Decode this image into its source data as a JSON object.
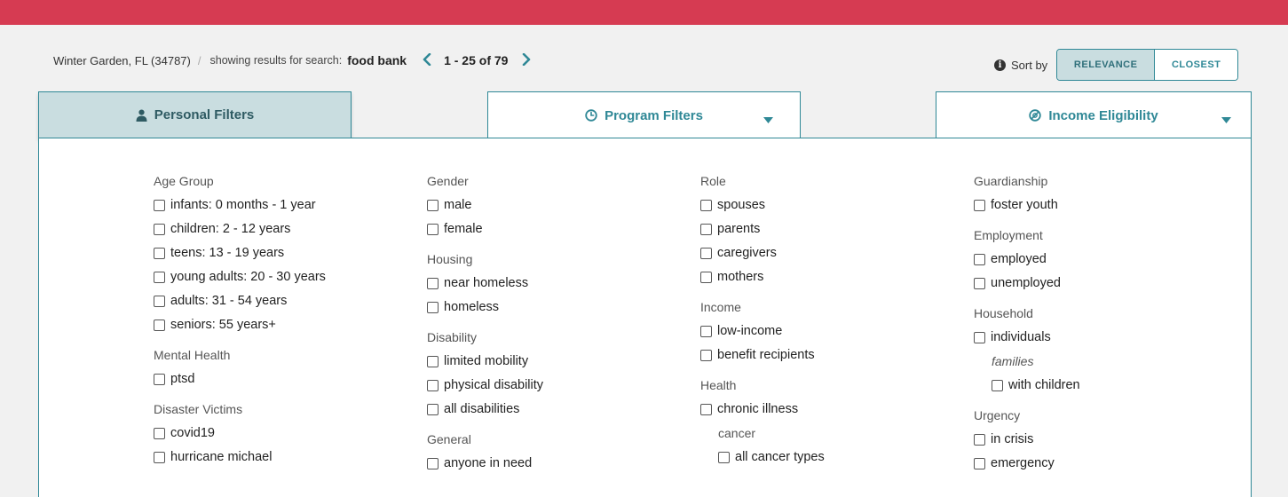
{
  "results": {
    "location": "Winter Garden, FL (34787)",
    "separator": "/",
    "search_prefix": "showing results for search:",
    "query": "food bank",
    "range": "1 - 25 of 79"
  },
  "sort": {
    "label": "Sort by",
    "options": [
      "RELEVANCE",
      "CLOSEST"
    ],
    "selected": "RELEVANCE"
  },
  "tabs": {
    "personal": "Personal Filters",
    "program": "Program Filters",
    "income": "Income Eligibility"
  },
  "colors": {
    "brand_red": "#d63b52",
    "teal": "#2f8896",
    "tab_active_bg": "#c9dde0"
  },
  "filters": {
    "col1": {
      "age_group": {
        "title": "Age Group",
        "items": [
          "infants: 0 months - 1 year",
          "children: 2 - 12 years",
          "teens: 13 - 19 years",
          "young adults: 20 - 30 years",
          "adults: 31 - 54 years",
          "seniors: 55 years+"
        ]
      },
      "mental_health": {
        "title": "Mental Health",
        "items": [
          "ptsd"
        ]
      },
      "disaster_victims": {
        "title": "Disaster Victims",
        "items": [
          "covid19",
          "hurricane michael"
        ]
      }
    },
    "col2": {
      "gender": {
        "title": "Gender",
        "items": [
          "male",
          "female"
        ]
      },
      "housing": {
        "title": "Housing",
        "items": [
          "near homeless",
          "homeless"
        ]
      },
      "disability": {
        "title": "Disability",
        "items": [
          "limited mobility",
          "physical disability",
          "all disabilities"
        ]
      },
      "general": {
        "title": "General",
        "items": [
          "anyone in need"
        ]
      }
    },
    "col3": {
      "role": {
        "title": "Role",
        "items": [
          "spouses",
          "parents",
          "caregivers",
          "mothers"
        ]
      },
      "income": {
        "title": "Income",
        "items": [
          "low-income",
          "benefit recipients"
        ]
      },
      "health": {
        "title": "Health",
        "items": [
          "chronic illness"
        ],
        "sub_title": "cancer",
        "sub_items": [
          "all cancer types"
        ]
      }
    },
    "col4": {
      "guardianship": {
        "title": "Guardianship",
        "items": [
          "foster youth"
        ]
      },
      "employment": {
        "title": "Employment",
        "items": [
          "employed",
          "unemployed"
        ]
      },
      "household": {
        "title": "Household",
        "items": [
          "individuals"
        ],
        "sub_title": "families",
        "sub_items": [
          "with children"
        ]
      },
      "urgency": {
        "title": "Urgency",
        "items": [
          "in crisis",
          "emergency"
        ]
      }
    }
  }
}
